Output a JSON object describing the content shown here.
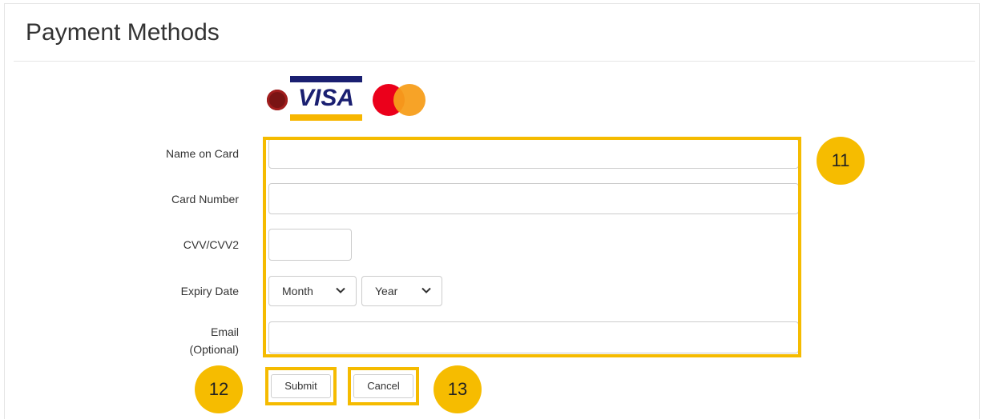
{
  "page": {
    "title": "Payment Methods"
  },
  "logos": {
    "visa_text": "VISA",
    "colors": {
      "visa_blue": "#1a1f71",
      "visa_gold": "#f7b600",
      "mc_red": "#eb001b",
      "mc_orange": "#f79e1b",
      "dot_red": "#7a1414"
    }
  },
  "form": {
    "name_label": "Name on Card",
    "name_value": "",
    "card_number_label": "Card Number",
    "card_number_value": "",
    "cvv_label": "CVV/CVV2",
    "cvv_value": "",
    "expiry_label": "Expiry Date",
    "month_selected": "Month",
    "year_selected": "Year",
    "email_label_line1": "Email",
    "email_label_line2": "(Optional)",
    "email_value": ""
  },
  "buttons": {
    "submit": "Submit",
    "cancel": "Cancel"
  },
  "callouts": {
    "form_fields": "11",
    "submit": "12",
    "cancel": "13",
    "color": "#f5bb00"
  }
}
